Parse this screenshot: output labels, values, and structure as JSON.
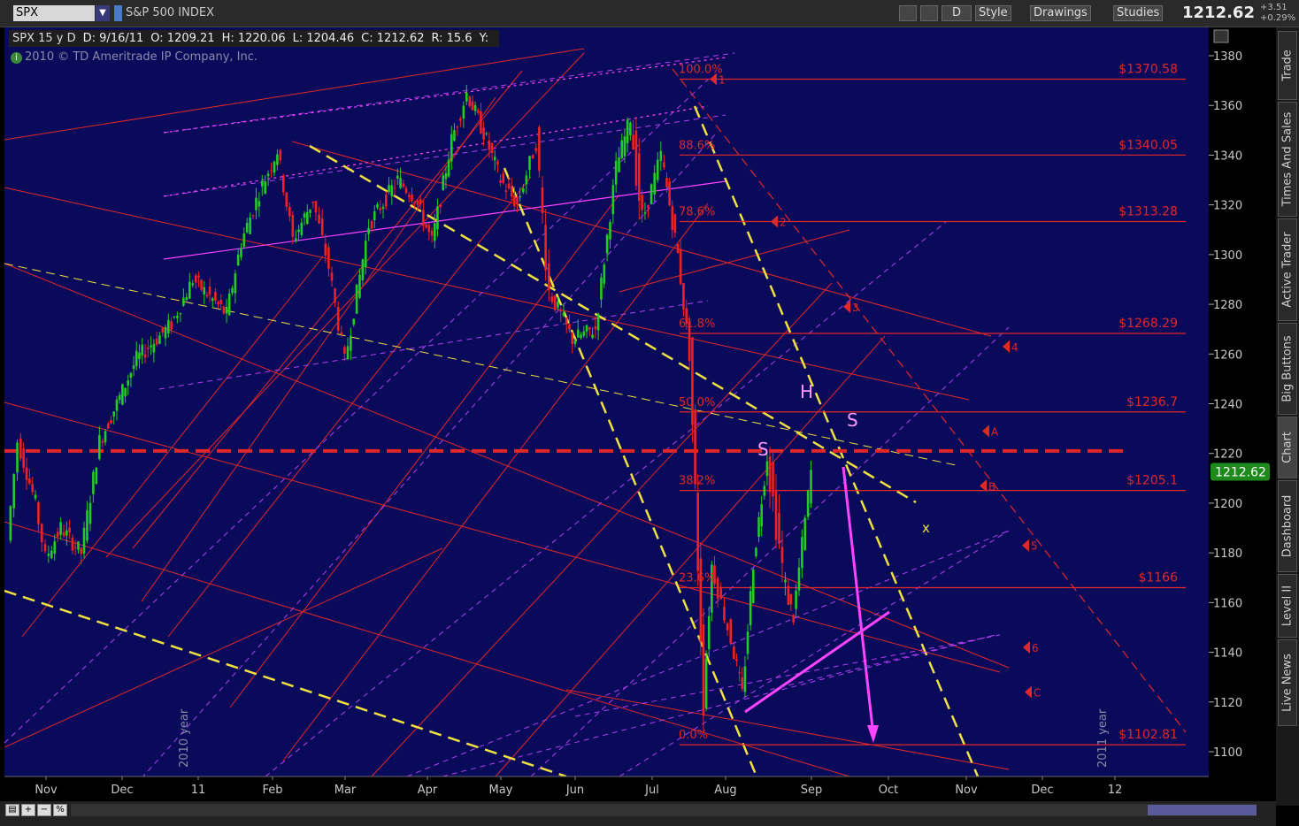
{
  "toolbar": {
    "symbol": "SPX",
    "index_name": "S&P 500 INDEX",
    "period_label": "D",
    "style_label": "Style",
    "drawings_label": "Drawings",
    "studies_label": "Studies",
    "last_price": "1212.62",
    "change_abs": "+3.51",
    "change_pct": "+0.29%"
  },
  "legend": {
    "symbol": "SPX 15 y D",
    "date": "D: 9/16/11",
    "open": "O: 1209.21",
    "high": "H: 1220.06",
    "low": "L: 1204.46",
    "close": "C: 1212.62",
    "range": "R: 15.6",
    "y": "Y:"
  },
  "copyright": "2010 © TD Ameritrade IP Company, Inc.",
  "side_tabs": [
    "Trade",
    "Times And Sales",
    "Active Trader",
    "Big Buttons",
    "Chart",
    "Dashboard",
    "Level II",
    "Live News"
  ],
  "colors": {
    "background": "#0a0a5a",
    "up": "#22cc22",
    "down": "#ee2222",
    "fib": "#e02828",
    "yellow": "#f0e040",
    "magenta": "#ff44ff",
    "violet": "#b040f0",
    "accent_green": "#1e8a1e"
  },
  "chart_data": {
    "type": "candlestick",
    "y_axis": {
      "min": 1095,
      "max": 1385,
      "ticks": [
        1100,
        1120,
        1140,
        1160,
        1180,
        1200,
        1220,
        1240,
        1260,
        1280,
        1300,
        1320,
        1340,
        1360,
        1380
      ]
    },
    "x_axis_labels": [
      "Nov",
      "Dec",
      "11",
      "Feb",
      "Mar",
      "Apr",
      "May",
      "Jun",
      "Jul",
      "Aug",
      "Sep",
      "Oct",
      "Nov",
      "Dec",
      "12"
    ],
    "year_markers": [
      "2010 year",
      "2011 year"
    ],
    "current_price": 1212.62,
    "fib_levels": [
      {
        "pct": "100.0%",
        "price": 1370.58,
        "label": "$1370.58"
      },
      {
        "pct": "88.6%",
        "price": 1340.05,
        "label": "$1340.05"
      },
      {
        "pct": "78.6%",
        "price": 1313.28,
        "label": "$1313.28"
      },
      {
        "pct": "61.8%",
        "price": 1268.29,
        "label": "$1268.29"
      },
      {
        "pct": "50.0%",
        "price": 1236.7,
        "label": "$1236.7"
      },
      {
        "pct": "38.2%",
        "price": 1205.1,
        "label": "$1205.1"
      },
      {
        "pct": "23.6%",
        "price": 1166,
        "label": "$1166"
      },
      {
        "pct": "0.0%",
        "price": 1102.81,
        "label": "$1102.81"
      }
    ],
    "neckline_price": 1221,
    "pattern_labels": [
      "S",
      "H",
      "S"
    ],
    "target_mark": "x",
    "markers": [
      "1",
      "2",
      "3",
      "4",
      "A",
      "B",
      "5",
      "6",
      "C"
    ],
    "price_path": [
      [
        "2010-11-01",
        1185
      ],
      [
        "2010-11-05",
        1225
      ],
      [
        "2010-11-12",
        1200
      ],
      [
        "2010-11-16",
        1178
      ],
      [
        "2010-11-22",
        1190
      ],
      [
        "2010-11-30",
        1180
      ],
      [
        "2010-12-07",
        1225
      ],
      [
        "2010-12-14",
        1240
      ],
      [
        "2010-12-22",
        1258
      ],
      [
        "2011-01-05",
        1272
      ],
      [
        "2011-01-14",
        1290
      ],
      [
        "2011-01-21",
        1283
      ],
      [
        "2011-01-28",
        1276
      ],
      [
        "2011-02-04",
        1305
      ],
      [
        "2011-02-11",
        1325
      ],
      [
        "2011-02-18",
        1342
      ],
      [
        "2011-02-24",
        1306
      ],
      [
        "2011-03-04",
        1322
      ],
      [
        "2011-03-10",
        1295
      ],
      [
        "2011-03-16",
        1257
      ],
      [
        "2011-03-25",
        1312
      ],
      [
        "2011-04-04",
        1330
      ],
      [
        "2011-04-11",
        1323
      ],
      [
        "2011-04-18",
        1305
      ],
      [
        "2011-04-26",
        1346
      ],
      [
        "2011-05-02",
        1365
      ],
      [
        "2011-05-09",
        1349
      ],
      [
        "2011-05-16",
        1330
      ],
      [
        "2011-05-23",
        1320
      ],
      [
        "2011-05-31",
        1345
      ],
      [
        "2011-06-06",
        1285
      ],
      [
        "2011-06-15",
        1266
      ],
      [
        "2011-06-24",
        1270
      ],
      [
        "2011-07-01",
        1335
      ],
      [
        "2011-07-07",
        1355
      ],
      [
        "2011-07-12",
        1313
      ],
      [
        "2011-07-20",
        1340
      ],
      [
        "2011-07-27",
        1300
      ],
      [
        "2011-08-03",
        1260
      ],
      [
        "2011-08-08",
        1120
      ],
      [
        "2011-08-11",
        1175
      ],
      [
        "2011-08-18",
        1145
      ],
      [
        "2011-08-22",
        1123
      ],
      [
        "2011-08-26",
        1176
      ],
      [
        "2011-08-31",
        1219
      ],
      [
        "2011-09-06",
        1165
      ],
      [
        "2011-09-09",
        1154
      ],
      [
        "2011-09-16",
        1212.62
      ]
    ]
  }
}
